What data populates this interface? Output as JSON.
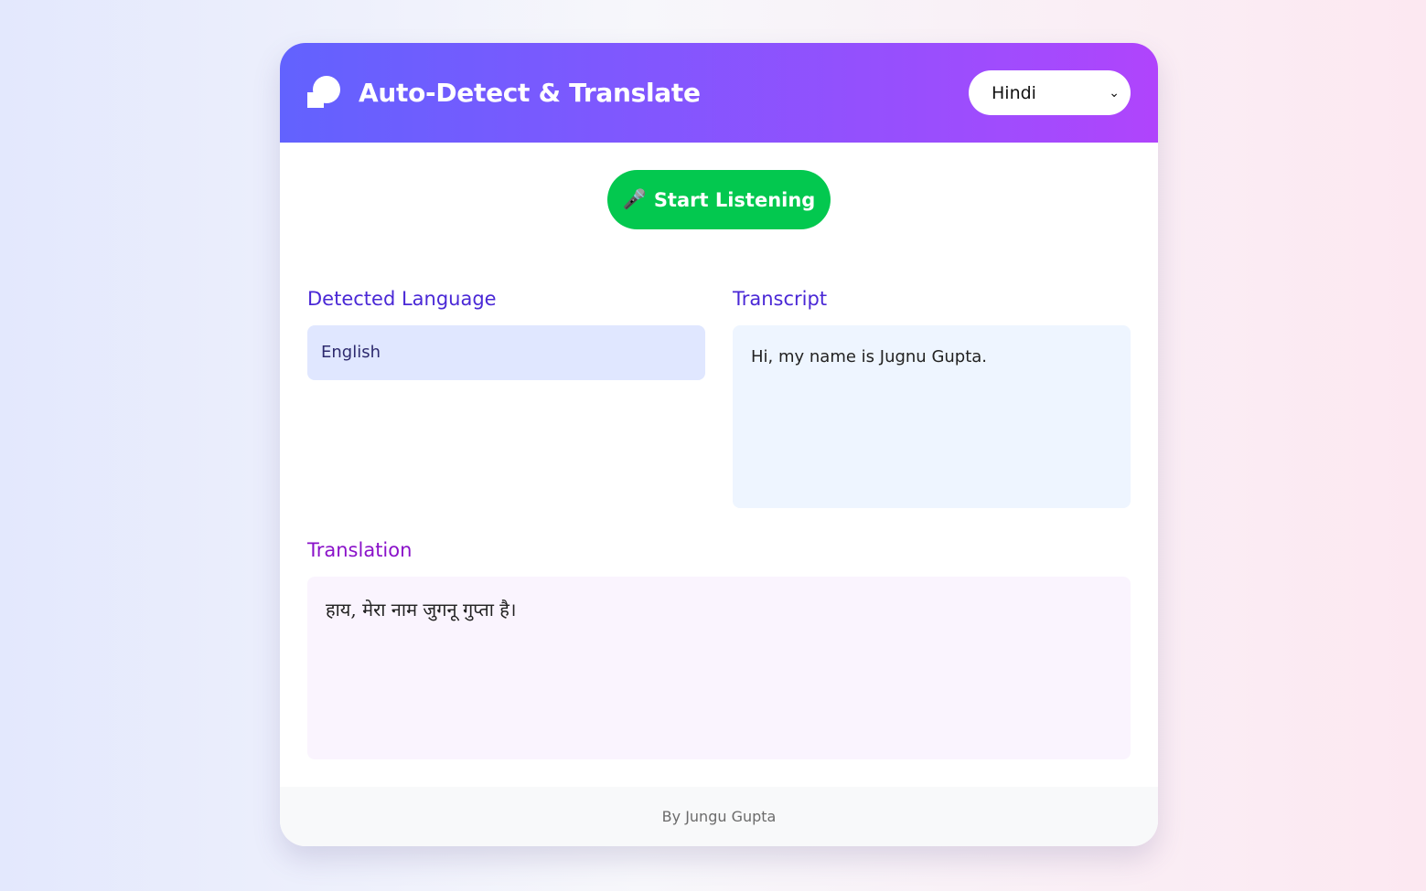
{
  "header": {
    "title": "Auto-Detect & Translate",
    "language_select": {
      "selected": "Hindi"
    }
  },
  "controls": {
    "start_label": "Start Listening",
    "mic_icon": "🎤"
  },
  "detected": {
    "label": "Detected Language",
    "value": "English"
  },
  "transcript": {
    "label": "Transcript",
    "value": "Hi, my name is Jugnu Gupta."
  },
  "translation": {
    "label": "Translation",
    "value": "हाय, मेरा नाम जुगनू गुप्ता है।"
  },
  "footer": {
    "text": "By Jungu Gupta"
  }
}
